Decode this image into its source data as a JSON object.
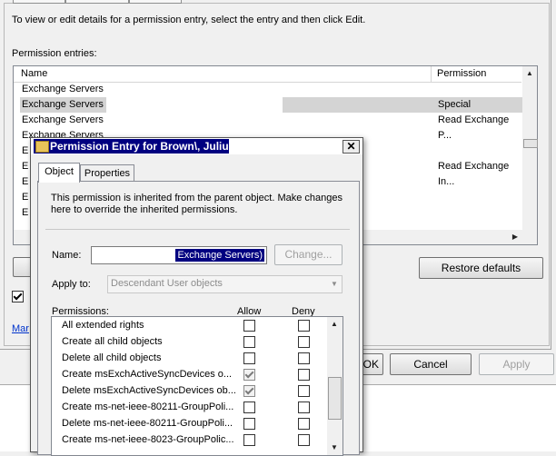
{
  "background": {
    "instruction": "To view or edit details for a permission entry, select the entry and then click Edit.",
    "permission_entries_label": "Permission entries:",
    "columns": {
      "name": "Name",
      "permission": "Permission"
    },
    "rows": [
      {
        "name": "Exchange Servers",
        "permission": ""
      },
      {
        "name": "Exchange Servers",
        "permission": "Special"
      },
      {
        "name": "Exchange Servers",
        "permission": "Read Exchange P..."
      },
      {
        "name": "Exchange Servers",
        "permission": ""
      },
      {
        "name": "E",
        "permission": ""
      },
      {
        "name": "E",
        "permission": "Read Exchange In..."
      },
      {
        "name": "E",
        "permission": ""
      },
      {
        "name": "E",
        "permission": ""
      },
      {
        "name": "E",
        "permission": ""
      }
    ],
    "restore_defaults_label": "Restore defaults",
    "checkbox_checked": true,
    "link_fragment": "Mar",
    "ok_label": "OK",
    "cancel_label": "Cancel",
    "apply_label": "Apply"
  },
  "dialog": {
    "title": "Permission Entry for Brown\\, Julius",
    "tabs": [
      {
        "label": "Object"
      },
      {
        "label": "Properties"
      }
    ],
    "inherited_note": "This permission is inherited from the parent object. Make changes here to override the inherited permissions.",
    "name_label": "Name:",
    "name_value": "Exchange Servers)",
    "change_label": "Change...",
    "apply_to_label": "Apply to:",
    "apply_to_value": "Descendant User objects",
    "permissions_label": "Permissions:",
    "allow_label": "Allow",
    "deny_label": "Deny",
    "permissions": [
      {
        "label": "All extended rights",
        "allow": false,
        "deny": false
      },
      {
        "label": "Create all child objects",
        "allow": false,
        "deny": false
      },
      {
        "label": "Delete all child objects",
        "allow": false,
        "deny": false
      },
      {
        "label": "Create msExchActiveSyncDevices o...",
        "allow": true,
        "deny": false
      },
      {
        "label": "Delete msExchActiveSyncDevices ob...",
        "allow": true,
        "deny": false
      },
      {
        "label": "Create ms-net-ieee-80211-GroupPoli...",
        "allow": false,
        "deny": false
      },
      {
        "label": "Delete ms-net-ieee-80211-GroupPoli...",
        "allow": false,
        "deny": false
      },
      {
        "label": "Create ms-net-ieee-8023-GroupPolic...",
        "allow": false,
        "deny": false
      }
    ]
  }
}
